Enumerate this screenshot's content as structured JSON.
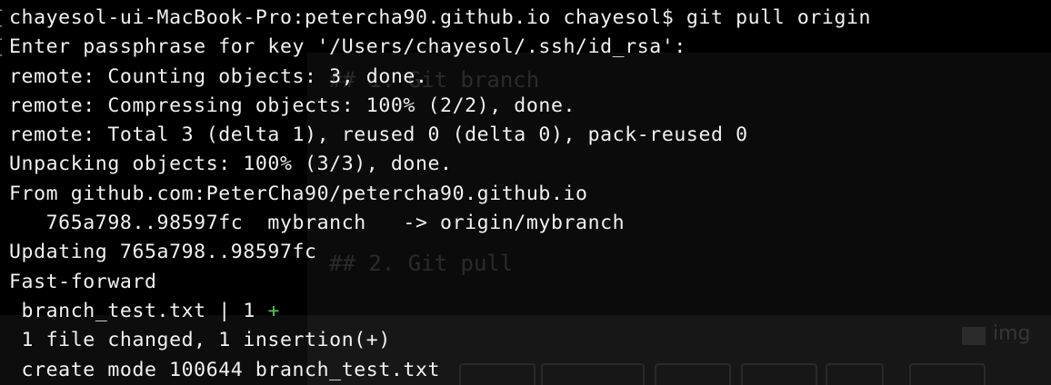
{
  "terminal": {
    "lines": [
      "chayesol-ui-MacBook-Pro:petercha90.github.io chayesol$ git pull origin",
      "Enter passphrase for key '/Users/chayesol/.ssh/id_rsa':",
      "remote: Counting objects: 3, done.",
      "remote: Compressing objects: 100% (2/2), done.",
      "remote: Total 3 (delta 1), reused 0 (delta 0), pack-reused 0",
      "Unpacking objects: 100% (3/3), done.",
      "From github.com:PeterCha90/petercha90.github.io",
      "   765a798..98597fc  mybranch   -> origin/mybranch",
      "Updating 765a798..98597fc",
      "Fast-forward",
      " branch_test.txt | 1 ",
      " 1 file changed, 1 insertion(+)",
      " create mode 100644 branch_test.txt"
    ],
    "diffstat_plus": "+",
    "colors": {
      "background": "#000000",
      "foreground": "#f2f2f2",
      "added": "#4cc94c"
    }
  },
  "background_editor": {
    "heading_branch": "## 1. Git branch",
    "heading_pull": "## 2. Git pull",
    "folder_label": "img"
  }
}
